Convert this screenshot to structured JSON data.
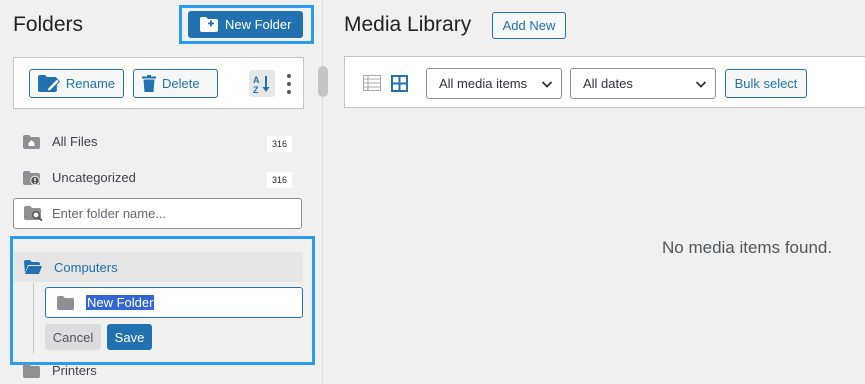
{
  "sidebar": {
    "title": "Folders",
    "new_folder_label": "New Folder",
    "rename_label": "Rename",
    "delete_label": "Delete",
    "sort_icon": "sort-az-icon",
    "items": [
      {
        "label": "All Files",
        "count": "316",
        "icon": "home-folder-icon"
      },
      {
        "label": "Uncategorized",
        "count": "316",
        "icon": "info-folder-icon"
      }
    ],
    "search_placeholder": "Enter folder name...",
    "computers_label": "Computers",
    "new_folder_input_value": "New Folder",
    "cancel_label": "Cancel",
    "save_label": "Save",
    "printers_label": "Printers"
  },
  "main": {
    "title": "Media Library",
    "add_new_label": "Add New",
    "filter_media": "All media items",
    "filter_dates": "All dates",
    "bulk_select_label": "Bulk select",
    "empty_message": "No media items found."
  },
  "colors": {
    "accent": "#2271b1",
    "highlight": "#2a9bf0"
  }
}
